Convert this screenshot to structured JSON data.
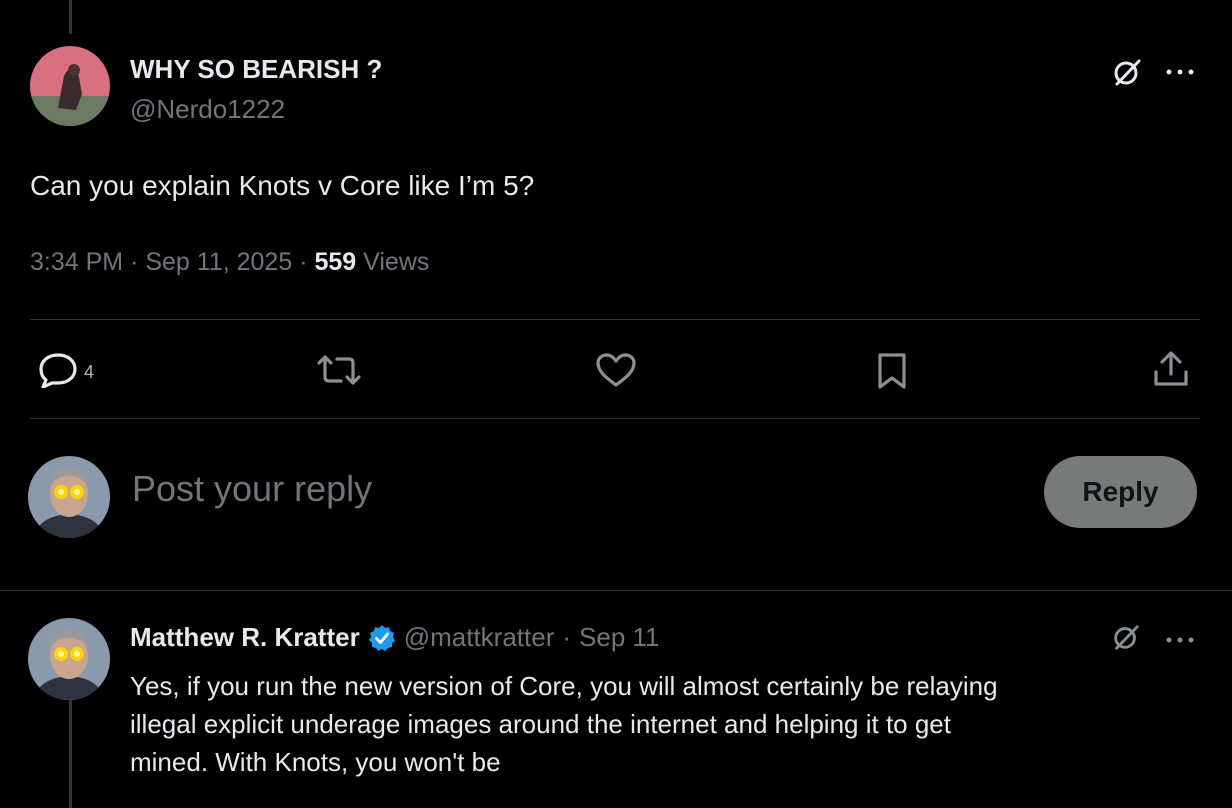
{
  "post": {
    "display_name": "WHY SO BEARISH ?",
    "handle": "@Nerdo1222",
    "text": "Can you explain Knots v Core like I’m 5?",
    "time": "3:34 PM",
    "date": "Sep 11, 2025",
    "views_count": "559",
    "views_label": "Views",
    "reply_count": "4"
  },
  "composer": {
    "placeholder": "Post your reply",
    "reply_button_label": "Reply"
  },
  "reply": {
    "display_name": "Matthew R. Kratter",
    "handle": "@mattkratter",
    "date": "Sep 11",
    "lines": [
      "Yes, if you run the new version of Core, you will almost certainly be relaying",
      "illegal explicit underage images around the internet and helping it to get",
      "mined. With Knots, you won't be"
    ]
  },
  "icons": {
    "grok": "grok-icon",
    "more": "more-icon",
    "reply": "reply-icon",
    "repost": "repost-icon",
    "like": "heart-icon",
    "bookmark": "bookmark-icon",
    "share": "share-icon",
    "verified": "verified-badge-icon"
  },
  "colors": {
    "background": "#000000",
    "text": "#e7e9ea",
    "muted": "#71767b",
    "verified": "#1d9bf0",
    "reply_button": "#787a7a"
  }
}
